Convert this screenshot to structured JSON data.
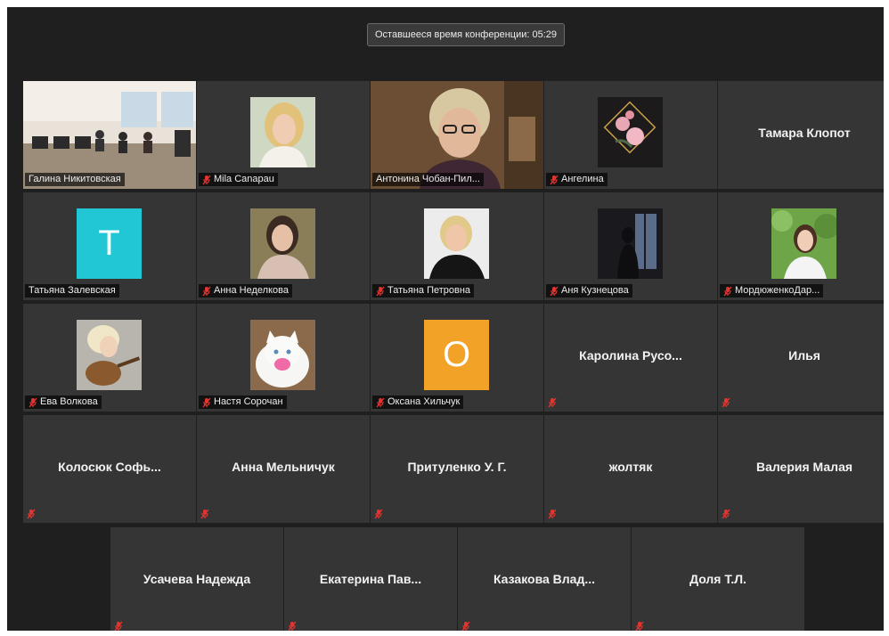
{
  "timer": "Оставшееся время конференции: 05:29",
  "colors": {
    "active_border": "#e6dd74",
    "tile_bg": "#353535",
    "mute_icon": "#e3342f"
  },
  "rows": [
    [
      {
        "name": "Галина Никитовская",
        "kind": "video-room",
        "muted": false
      },
      {
        "name": "Mila Canapau",
        "kind": "photo-woman-blonde",
        "muted": true
      },
      {
        "name": "Антонина Чобан-Пил...",
        "kind": "video-speaker",
        "muted": false,
        "active": true
      },
      {
        "name": "Ангелина",
        "kind": "photo-flowers",
        "muted": true
      },
      {
        "name": "Тамара Клопот",
        "kind": "name",
        "muted": false
      }
    ],
    [
      {
        "name": "Татьяна Залевская",
        "kind": "letter",
        "letter": "T",
        "color": "#22c7d6",
        "muted": false
      },
      {
        "name": "Анна Неделкова",
        "kind": "photo-woman-dark",
        "muted": true
      },
      {
        "name": "Татьяна Петровна",
        "kind": "photo-woman-blonde2",
        "muted": true
      },
      {
        "name": "Аня Кузнецова",
        "kind": "photo-silhouette",
        "muted": true
      },
      {
        "name": "МордюженкоДар...",
        "kind": "photo-woman-nature",
        "muted": true
      }
    ],
    [
      {
        "name": "Ева Волкова",
        "kind": "photo-guitar",
        "muted": true
      },
      {
        "name": "Настя Сорочан",
        "kind": "photo-cat",
        "muted": true
      },
      {
        "name": "Оксана Хильчук",
        "kind": "letter",
        "letter": "О",
        "color": "#f2a227",
        "muted": true
      },
      {
        "name": "Каролина Русо...",
        "kind": "name",
        "muted": true
      },
      {
        "name": "Илья",
        "kind": "name",
        "muted": true
      }
    ],
    [
      {
        "name": "Колосюк Софь...",
        "kind": "name",
        "muted": true
      },
      {
        "name": "Анна Мельничук",
        "kind": "name",
        "muted": true
      },
      {
        "name": "Притуленко У. Г.",
        "kind": "name",
        "muted": true
      },
      {
        "name": "жолтяк",
        "kind": "name",
        "muted": true
      },
      {
        "name": "Валерия Малая",
        "kind": "name",
        "muted": true
      }
    ],
    [
      {
        "name": "Усачева Надежда",
        "kind": "name",
        "muted": true
      },
      {
        "name": "Екатерина Пав...",
        "kind": "name",
        "muted": true
      },
      {
        "name": "Казакова Влад...",
        "kind": "name",
        "muted": true
      },
      {
        "name": "Доля Т.Л.",
        "kind": "name",
        "muted": true
      }
    ]
  ]
}
